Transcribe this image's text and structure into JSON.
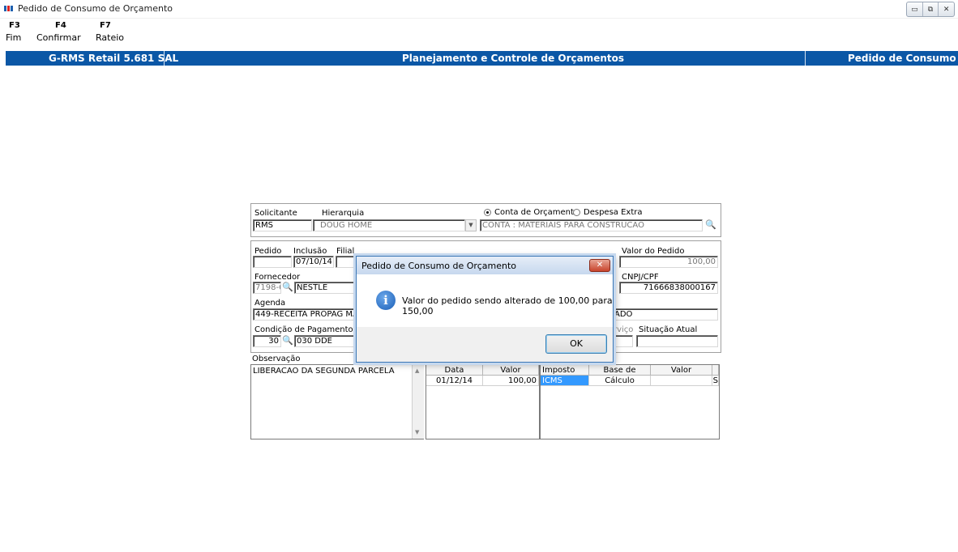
{
  "window": {
    "title": "Pedido de Consumo de Orçamento",
    "controls": [
      "▭",
      "⧉",
      "✕"
    ]
  },
  "toolbar": {
    "items": [
      {
        "key": "F3",
        "label": "Fim"
      },
      {
        "key": "F4",
        "label": "Confirmar"
      },
      {
        "key": "F7",
        "label": "Rateio"
      }
    ]
  },
  "banner": {
    "left": "G-RMS Retail 5.681 SAL",
    "center": "Planejamento e Controle de Orçamentos",
    "right": "Pedido de Consumo",
    "color": "#0b57a6"
  },
  "form": {
    "solicitante_label": "Solicitante",
    "solicitante_value": "RMS",
    "hierarquia_label": "Hierarquia",
    "hierarquia_value": "DOUG HOME",
    "radio_conta_label": "Conta de Orçamento",
    "radio_despesa_label": "Despesa Extra",
    "conta_value": "CONTA : MATERIAIS PARA CONSTRUCAO",
    "pedido_label": "Pedido",
    "pedido_value": "",
    "inclusao_label": "Inclusão",
    "inclusao_value": "07/10/14",
    "filial_label": "Filial",
    "valor_pedido_label": "Valor do Pedido",
    "valor_pedido_value": "100,00",
    "fornecedor_label": "Fornecedor",
    "fornecedor_code": "7198-6",
    "fornecedor_name": "NESTLE",
    "cnpj_label": "CNPJ/CPF",
    "cnpj_value": "71666838000167",
    "agenda_label": "Agenda",
    "agenda_value": "449-RECEITA PROPAG MARKI",
    "agenda_right_value": "ADO",
    "condicao_label": "Condição de Pagamento",
    "condicao_code": "30",
    "condicao_value": "030 DDE",
    "servico_label_partial": "rviço",
    "situacao_label": "Situação Atual",
    "observacao_label": "Observação",
    "observacao_value": "LIBERACAO DA SEGUNDA PARCELA"
  },
  "parcelas": {
    "headers": [
      "Data",
      "Valor"
    ],
    "rows": [
      [
        "01/12/14",
        "100,00"
      ]
    ]
  },
  "impostos": {
    "headers": [
      "Imposto",
      "Base de Cálculo",
      "Valor",
      ""
    ],
    "rows": [
      [
        "ICMS",
        "",
        "",
        "S"
      ]
    ]
  },
  "dialog": {
    "title": "Pedido de Consumo de Orçamento",
    "message": "Valor do pedido sendo alterado de 100,00 para 150,00",
    "ok_label": "OK",
    "icon": "i"
  }
}
